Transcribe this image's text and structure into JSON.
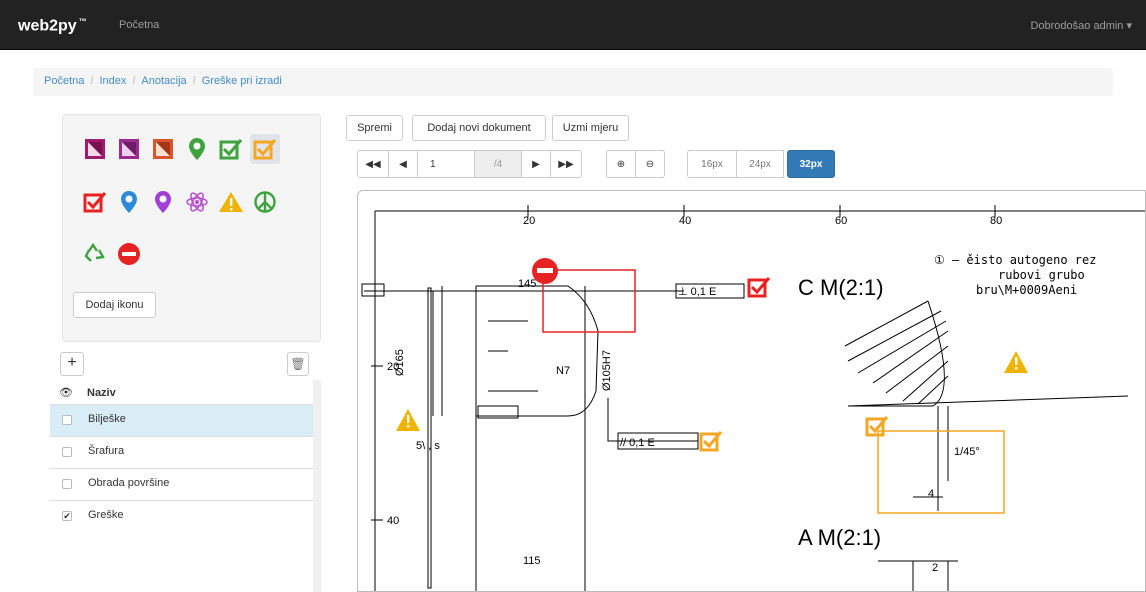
{
  "navbar": {
    "brand": "web2py",
    "brand_tm": "™",
    "home": "Početna",
    "user": "Dobrodošao admin ▾"
  },
  "breadcrumb": [
    "Početna",
    "Index",
    "Anotacija",
    "Greške pri izradi"
  ],
  "icon_panel": {
    "icons": [
      "image-marker-magenta-icon",
      "image-marker-purple-icon",
      "image-marker-orange-icon",
      "map-marker-green-icon",
      "checkbox-green-icon",
      "checkbox-orange-icon",
      "checkbox-red-icon",
      "map-marker-blue-icon",
      "map-marker-purple-icon",
      "atom-icon",
      "warning-icon",
      "peace-icon",
      "recycle-icon",
      "no-entry-icon"
    ],
    "add_icon_label": "Dodaj ikonu"
  },
  "layers": {
    "header": "Naziv",
    "items": [
      {
        "label": "Bilješke",
        "checked": false,
        "active": true
      },
      {
        "label": "Šrafura",
        "checked": false,
        "active": false
      },
      {
        "label": "Obrada površine",
        "checked": false,
        "active": false
      },
      {
        "label": "Greške",
        "checked": true,
        "active": false
      }
    ]
  },
  "toolbar": {
    "save": "Spremi",
    "add_document": "Dodaj novi dokument",
    "measure": "Uzmi mjeru"
  },
  "pager": {
    "first": "◀◀",
    "prev": "◀",
    "page": "1",
    "total": "/4",
    "next": "▶",
    "last": "▶▶"
  },
  "sizes": {
    "s16": "16px",
    "s24": "24px",
    "s32": "32px",
    "active": "32px"
  },
  "drawing": {
    "ruler": [
      "20",
      "40",
      "60",
      "80"
    ],
    "left_ruler": [
      "20",
      "40"
    ],
    "dims": [
      "145",
      "Ø165",
      "Ø105H7",
      "N7",
      "115",
      "1/45°",
      "4",
      "2"
    ],
    "tolerance1": "⊥ 0,1 E",
    "tolerance2": "// 0,1 E",
    "view_c": "C M(2:1)",
    "view_a": "A M(2:1)",
    "note1": "① – ěisto autogeno rez",
    "note2": "rubovi grubo",
    "note3": "bru\\M+0009Aeni",
    "surface": "5\\ , s"
  },
  "colors": {
    "accent": "#428bca",
    "active": "#337ab7",
    "navbar": "#222222",
    "error": "#e62222",
    "warn": "#f0b400",
    "orange": "#f5a623"
  }
}
